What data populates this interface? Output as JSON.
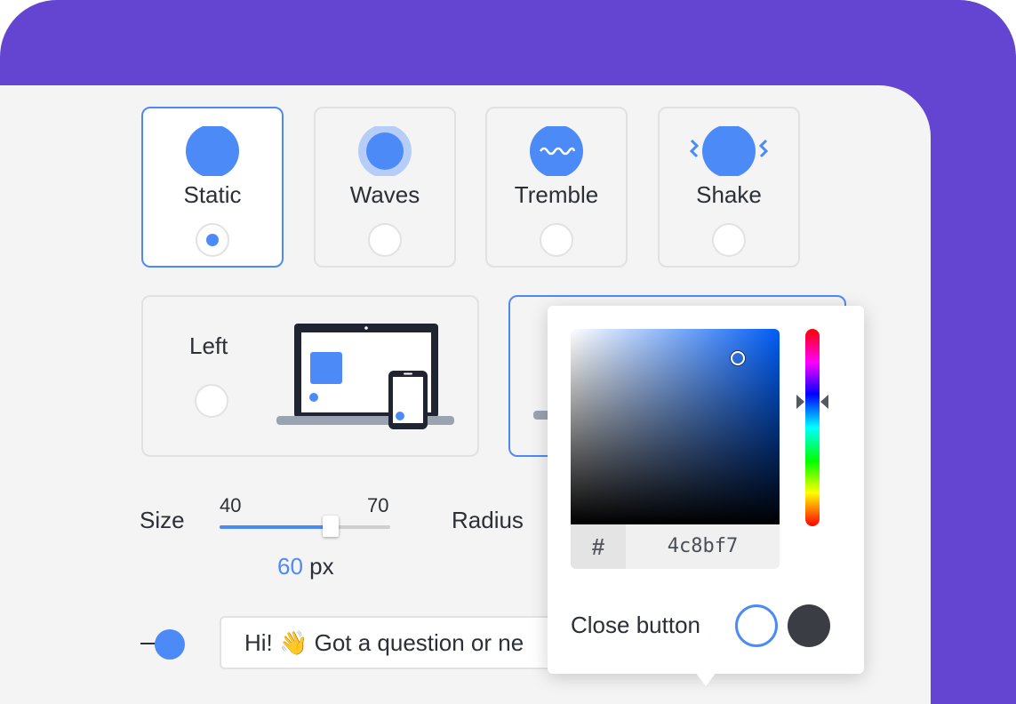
{
  "animations": [
    {
      "label": "Static",
      "selected": true
    },
    {
      "label": "Waves",
      "selected": false
    },
    {
      "label": "Tremble",
      "selected": false
    },
    {
      "label": "Shake",
      "selected": false
    }
  ],
  "position": {
    "left_label": "Left"
  },
  "size": {
    "label": "Size",
    "min": "40",
    "max": "70",
    "value": "60",
    "unit": "px"
  },
  "radius": {
    "label": "Radius"
  },
  "greeting": {
    "text": "Hi! 👋 Got a question or ne"
  },
  "color_picker": {
    "hash": "#",
    "hex_value": "4c8bf7",
    "close_button_label": "Close button"
  },
  "colors": {
    "accent": "#4c8bf7",
    "brand_purple": "#6345d2",
    "dark_swatch": "#3a3d44"
  },
  "icons": {
    "static": "circle-icon",
    "waves": "waves-circle-icon",
    "tremble": "tremble-wave-icon",
    "shake": "shake-icon",
    "desktop": "laptop-icon",
    "mobile": "phone-icon"
  }
}
